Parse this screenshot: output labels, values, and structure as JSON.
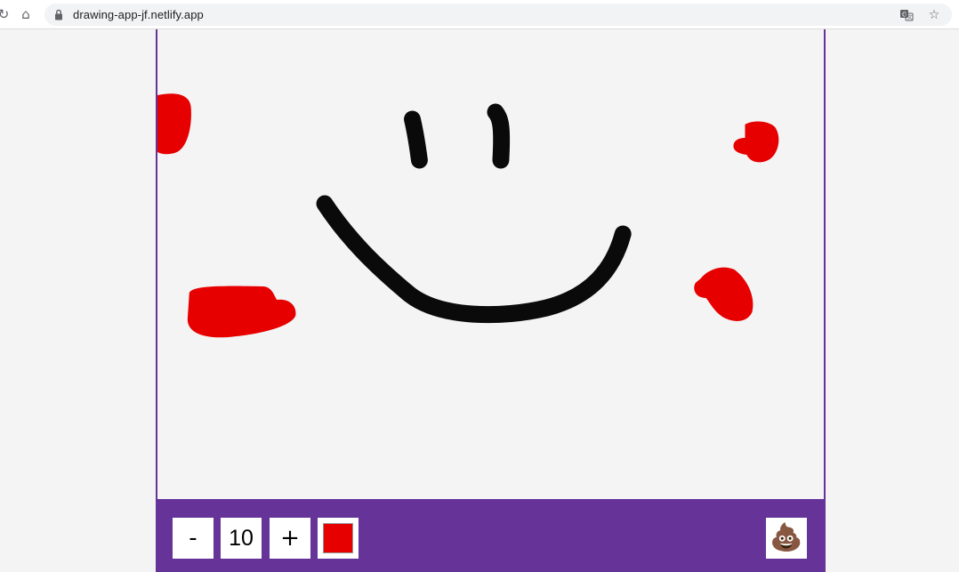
{
  "browser": {
    "url": "drawing-app-jf.netlify.app",
    "icons": {
      "reload": "reload-icon",
      "home": "home-icon",
      "lock": "lock-icon",
      "translate": "translate-icon",
      "bookmark": "star-icon"
    }
  },
  "app": {
    "border_color": "#663399",
    "canvas_background": "#f4f4f4",
    "toolbox": {
      "background": "#663399",
      "decrease_label": "-",
      "size_value": "10",
      "increase_label": "+",
      "selected_color": "#e60000",
      "clear_label": "💩"
    },
    "strokes": {
      "black": "#0a0a0a",
      "red": "#e60000"
    }
  }
}
